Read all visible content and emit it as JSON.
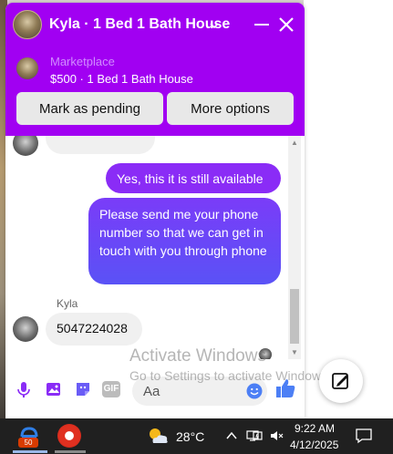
{
  "chat": {
    "title": "Kyla · 1 Bed 1 Bath House",
    "marketplace_label": "Marketplace",
    "listing": "$500 · 1 Bed 1 Bath House",
    "mark_pending_label": "Mark as pending",
    "more_options_label": "More options",
    "messages": [
      {
        "direction": "in",
        "text": ""
      },
      {
        "direction": "out",
        "text": "Yes, this it is still available"
      },
      {
        "direction": "out",
        "text": "Please send me your phone number so that we can get in touch with you through phone"
      },
      {
        "direction": "in",
        "sender": "Kyla",
        "text": "5047224028"
      }
    ],
    "composer": {
      "placeholder": "Aa"
    }
  },
  "watermark": {
    "line1": "Activate Windows",
    "line2": "Go to Settings to activate Windows."
  },
  "taskbar": {
    "badge_count": "50",
    "temperature": "28°C",
    "time": "9:22 AM",
    "date": "4/12/2025"
  },
  "colors": {
    "header": "#a100f2",
    "outgoing_bubble": "#8a2cf6",
    "outgoing_bubble_2": "#5a52f6",
    "incoming_bubble": "#f0f0f0",
    "taskbar": "#202020"
  }
}
